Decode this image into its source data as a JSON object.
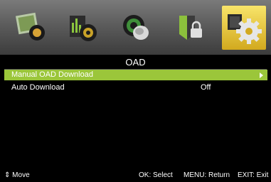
{
  "tabs": [
    {
      "icon": "picture-icon"
    },
    {
      "icon": "sound-icon"
    },
    {
      "icon": "channel-icon"
    },
    {
      "icon": "lock-icon"
    },
    {
      "icon": "settings-gear-icon",
      "active": true
    }
  ],
  "menu": {
    "title": "OAD",
    "items": [
      {
        "label": "Manual OAD Download",
        "value": ""
      },
      {
        "label": "Auto Download",
        "value": "Off"
      }
    ]
  },
  "footer": {
    "move": "Move",
    "select": "OK: Select",
    "return": "MENU: Return",
    "exit": "EXIT: Exit"
  },
  "colors": {
    "highlight": "#9bc63a",
    "active_tab": "#e9c640"
  }
}
